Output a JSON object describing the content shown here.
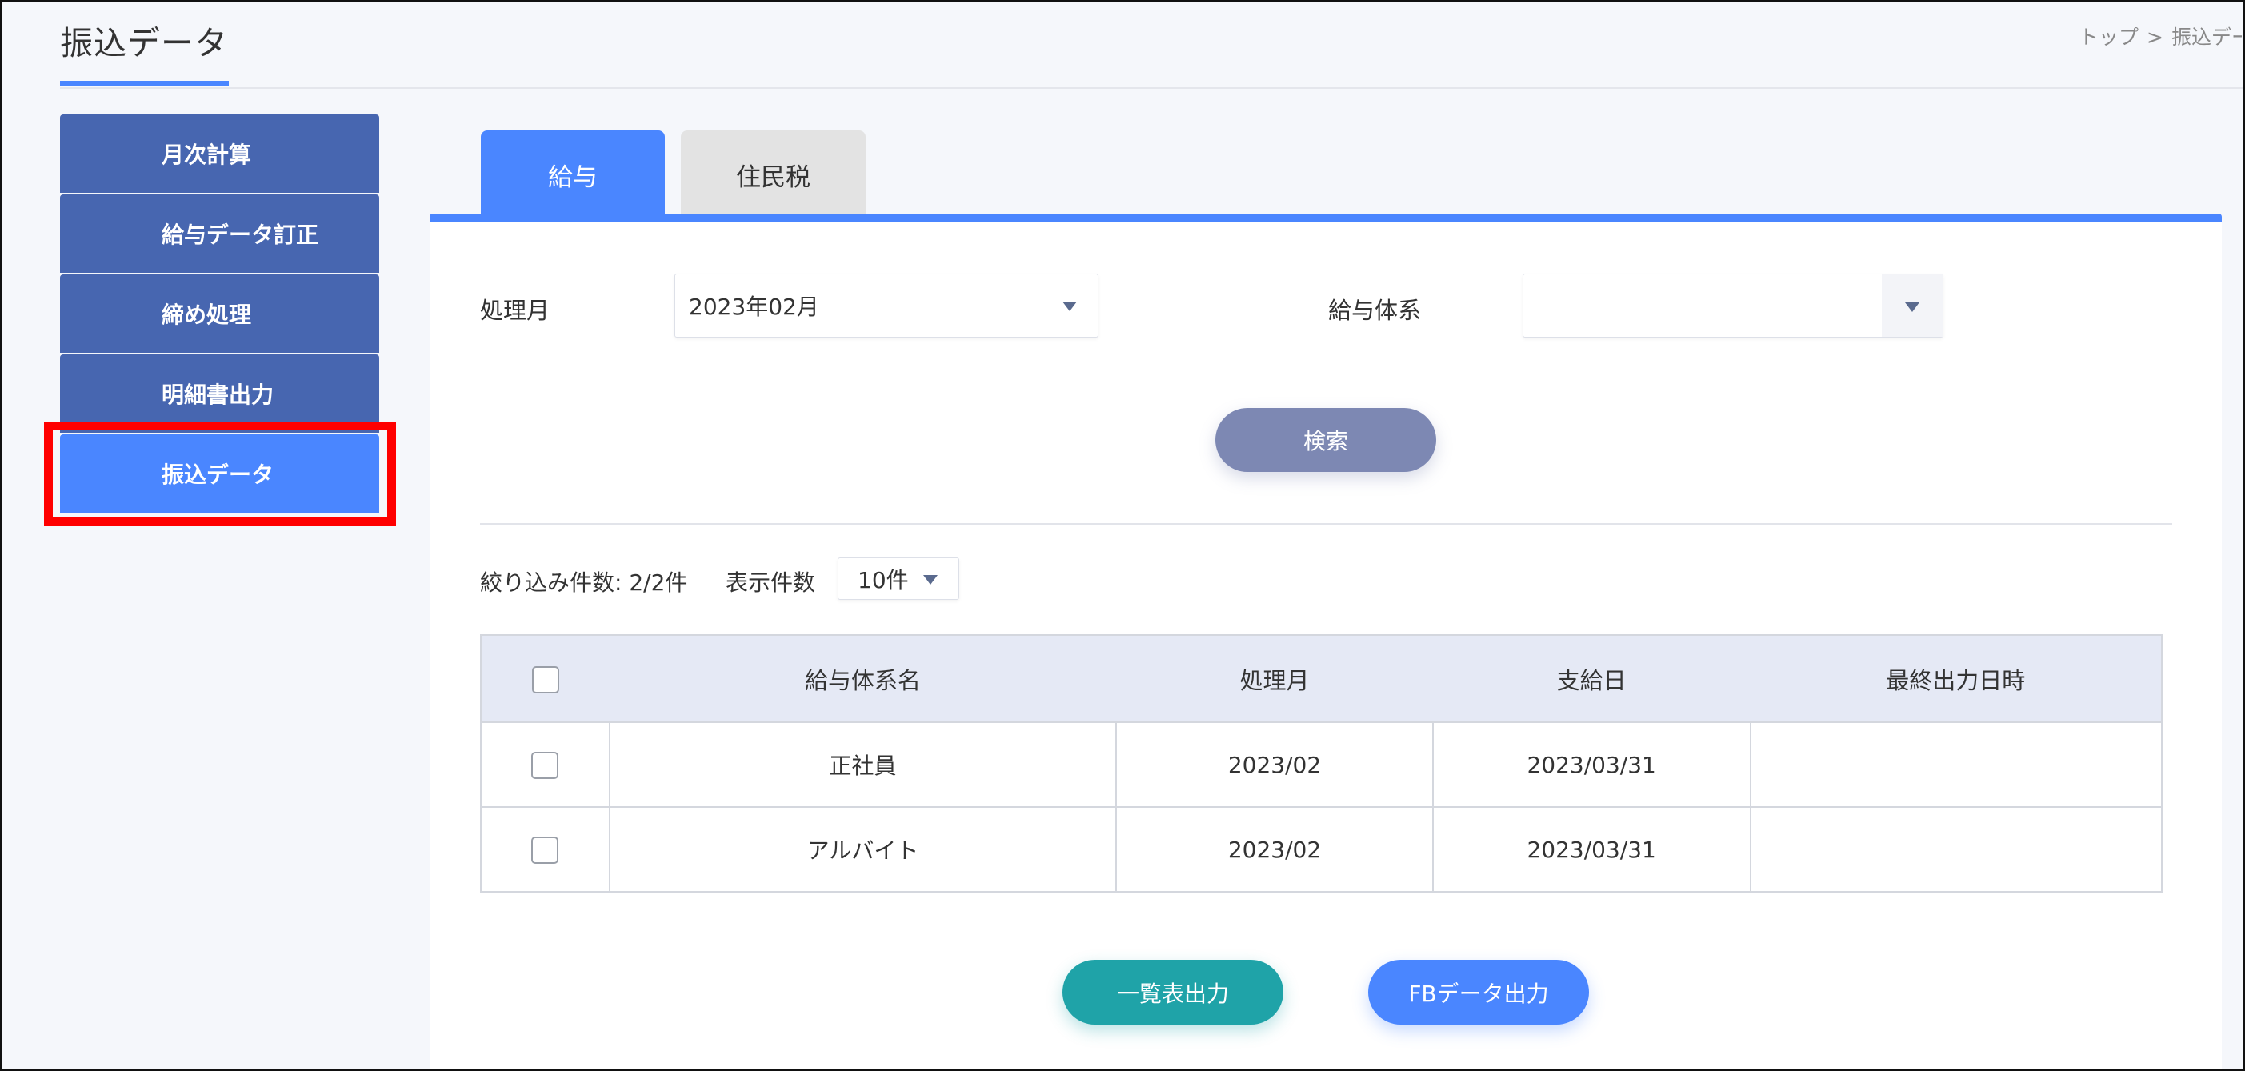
{
  "header": {
    "title": "振込データ",
    "breadcrumb": [
      "トップ",
      "振込デー"
    ]
  },
  "sidebar": {
    "items": [
      {
        "label": "月次計算"
      },
      {
        "label": "給与データ訂正"
      },
      {
        "label": "締め処理"
      },
      {
        "label": "明細書出力"
      },
      {
        "label": "振込データ",
        "active": true
      }
    ]
  },
  "tabs": [
    {
      "label": "給与",
      "active": true
    },
    {
      "label": "住民税",
      "active": false
    }
  ],
  "filters": {
    "month_label": "処理月",
    "month_value": "2023年02月",
    "system_label": "給与体系",
    "system_value": ""
  },
  "search_button": "検索",
  "results": {
    "count_text": "絞り込み件数: 2/2件",
    "per_page_label": "表示件数",
    "per_page_value": "10件"
  },
  "table": {
    "headers": [
      "",
      "給与体系名",
      "処理月",
      "支給日",
      "最終出力日時"
    ],
    "rows": [
      {
        "name": "正社員",
        "month": "2023/02",
        "pay_date": "2023/03/31",
        "last_output": ""
      },
      {
        "name": "アルバイト",
        "month": "2023/02",
        "pay_date": "2023/03/31",
        "last_output": ""
      }
    ]
  },
  "actions": {
    "list_output": "一覧表出力",
    "fb_output": "FBデータ出力"
  },
  "colors": {
    "accent": "#4a86ff",
    "sidebar": "#4766b0",
    "search_button": "#7d88b3",
    "list_button": "#1fa3a8",
    "highlight": "#ff0000"
  }
}
